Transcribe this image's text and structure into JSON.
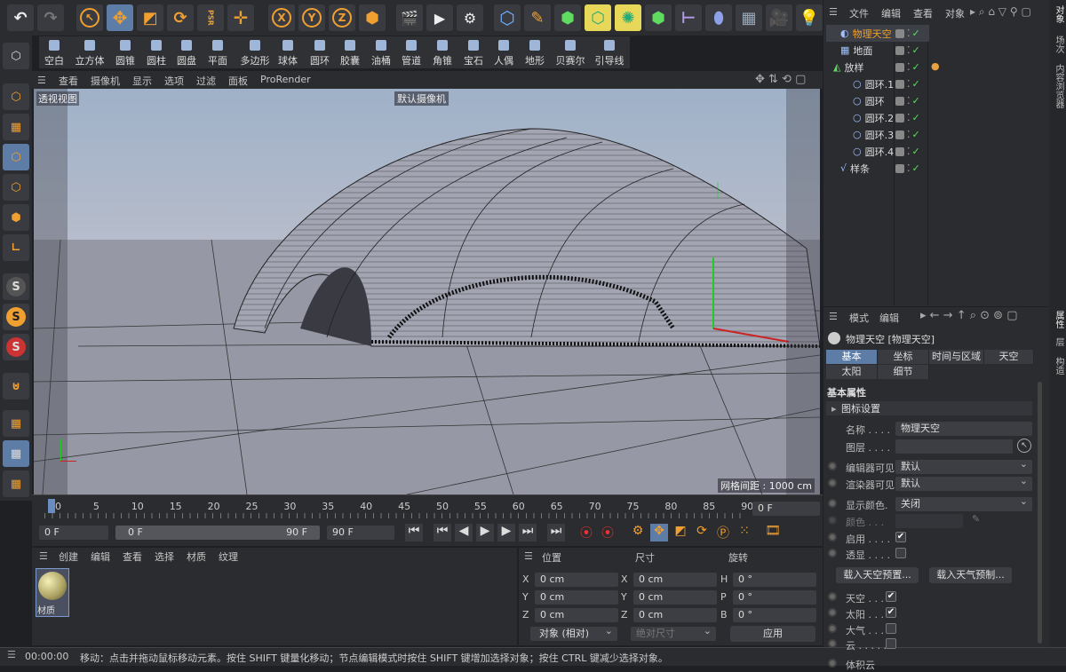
{
  "toolbar": {
    "undo": "↶",
    "redo": "↷",
    "x": "X",
    "y": "Y",
    "z": "Z",
    "psr": "PSR"
  },
  "primitives": [
    "空白",
    "立方体",
    "圆锥",
    "圆柱",
    "圆盘",
    "平面",
    "多边形",
    "球体",
    "圆环",
    "胶囊",
    "油桶",
    "管道",
    "角锥",
    "宝石",
    "人偶",
    "地形",
    "贝赛尔",
    "引导线"
  ],
  "viewport": {
    "menu": [
      "查看",
      "摄像机",
      "显示",
      "选项",
      "过滤",
      "面板",
      "ProRender"
    ],
    "view_name": "透视视图",
    "camera": "默认摄像机",
    "grid": "网格间距 : 1000 cm"
  },
  "objmgr": {
    "menu": [
      "文件",
      "编辑",
      "查看",
      "对象"
    ],
    "items": [
      "物理天空",
      "地面",
      "放样",
      "圆环.1",
      "圆环",
      "圆环.2",
      "圆环.3",
      "圆环.4",
      "样条"
    ]
  },
  "rightstrip": {
    "top": [
      "对象",
      "场次",
      "内容浏览器"
    ],
    "bottom": [
      "属性",
      "层",
      "构造"
    ]
  },
  "attr": {
    "menu": [
      "模式",
      "编辑"
    ],
    "title": "物理天空 [物理天空]",
    "tabs": [
      "基本",
      "坐标",
      "时间与区域",
      "天空",
      "太阳",
      "细节"
    ],
    "section": "基本属性",
    "subsection": "图标设置",
    "name_label": "名称 . . . .",
    "name_value": "物理天空",
    "layer_label": "图层 . . . .",
    "editor_label": "编辑器可见",
    "editor_value": "默认",
    "render_label": "渲染器可见",
    "render_value": "默认",
    "color_label": "显示颜色.",
    "color_value": "关闭",
    "color2_label": "颜色 . . .",
    "enable_label": "启用 . . . .",
    "xray_label": "透显 . . . .",
    "btn1": "载入天空预置...",
    "btn2": "载入天气预制...",
    "sky_label": "天空 . . .",
    "sun_label": "太阳 . . .",
    "atmo_label": "大气 . . .",
    "cloud_label": "云 . . . . .",
    "more_label": "体积云"
  },
  "timeline": {
    "ticks": [
      "0",
      "5",
      "10",
      "15",
      "20",
      "25",
      "30",
      "35",
      "40",
      "45",
      "50",
      "55",
      "60",
      "65",
      "70",
      "75",
      "80",
      "85",
      "90"
    ],
    "frame_right": "0 F",
    "start": "0 F",
    "range_start": "0 F",
    "range_end": "90 F",
    "end": "90 F"
  },
  "material": {
    "menu": [
      "创建",
      "编辑",
      "查看",
      "选择",
      "材质",
      "纹理"
    ],
    "name": "材质"
  },
  "coords": {
    "headers": [
      "位置",
      "尺寸",
      "旋转"
    ],
    "rows": [
      {
        "a": "X",
        "av": "0 cm",
        "b": "X",
        "bv": "0 cm",
        "c": "H",
        "cv": "0 °"
      },
      {
        "a": "Y",
        "av": "0 cm",
        "b": "Y",
        "bv": "0 cm",
        "c": "P",
        "cv": "0 °"
      },
      {
        "a": "Z",
        "av": "0 cm",
        "b": "Z",
        "bv": "0 cm",
        "c": "B",
        "cv": "0 °"
      }
    ],
    "mode": "对象 (相对)",
    "size_mode": "绝对尺寸",
    "apply": "应用"
  },
  "status": {
    "time": "00:00:00",
    "msg": "移动：点击并拖动鼠标移动元素。按住 SHIFT 键量化移动；节点编辑模式时按住 SHIFT 键增加选择对象；按住 CTRL 键减少选择对象。"
  }
}
